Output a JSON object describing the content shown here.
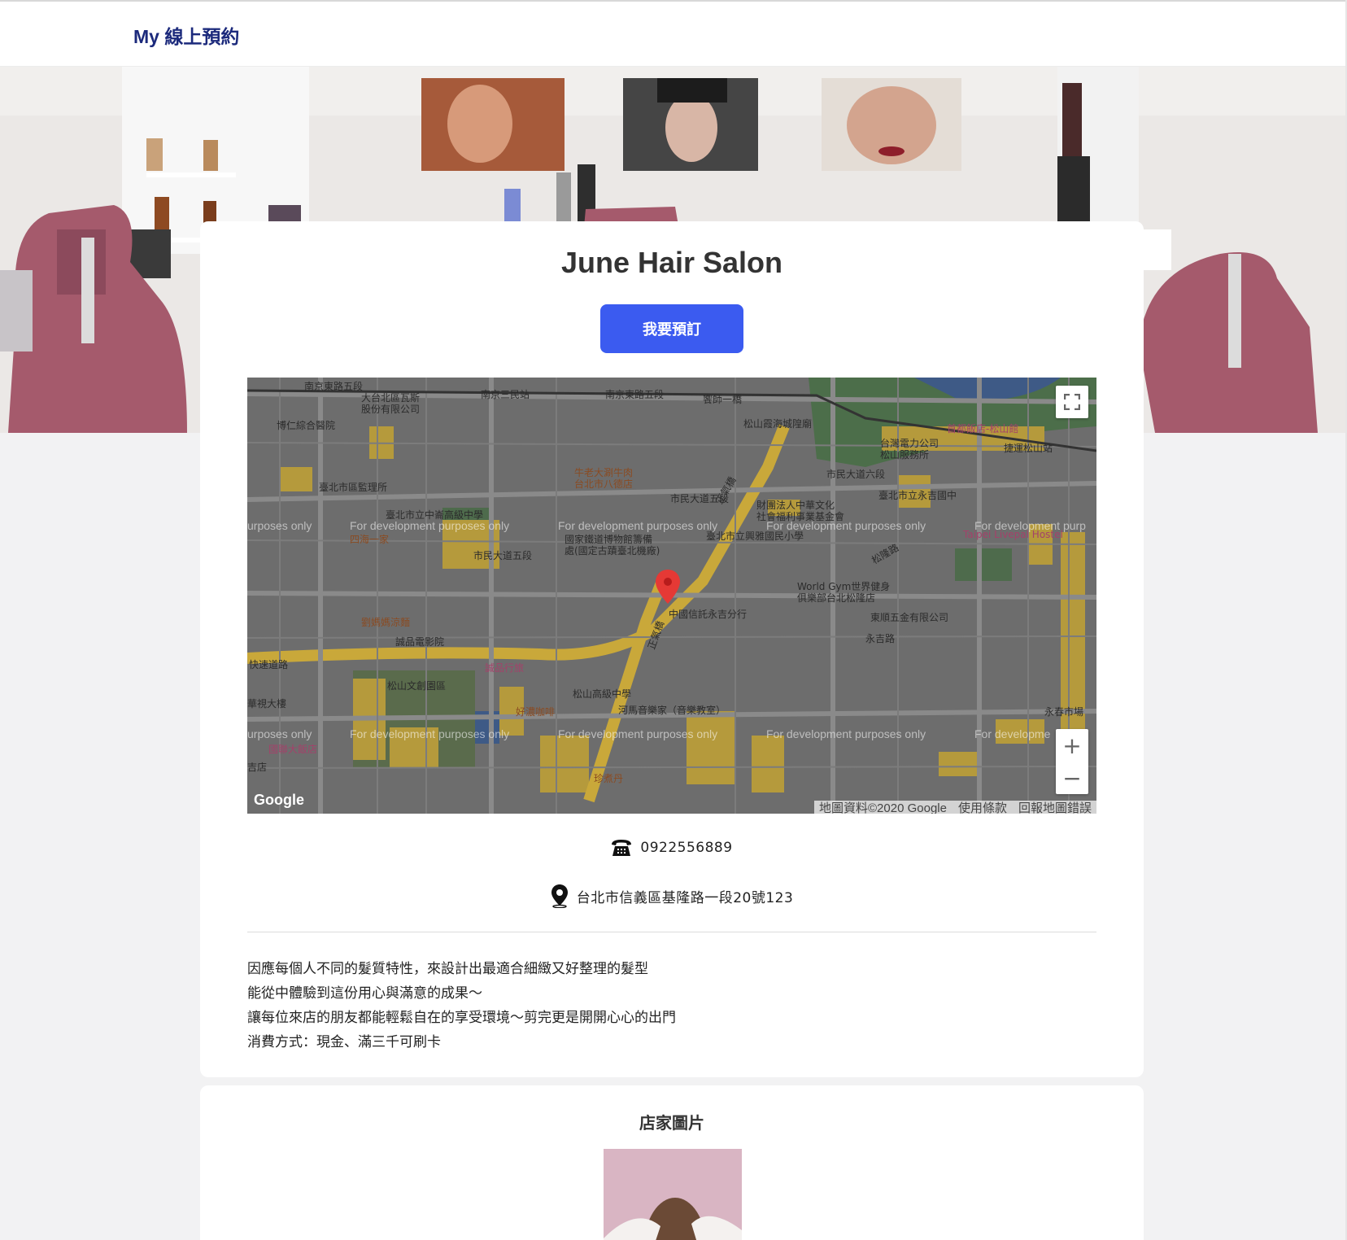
{
  "nav": {
    "brand": "My 線上預約"
  },
  "shop": {
    "name": "June Hair Salon",
    "book_label": "我要預訂",
    "phone": "0922556889",
    "address": "台北市信義區基隆路一段20號123",
    "description": [
      "因應每個人不同的髮質特性，來設計出最適合細緻又好整理的髮型",
      "能從中體驗到這份用心與滿意的成果～",
      "讓每位來店的朋友都能輕鬆自在的享受環境～剪完更是開開心心的出門",
      "消費方式：現金、滿三千可刷卡"
    ]
  },
  "map": {
    "dev_watermark": "For development purposes only",
    "dev_watermark_partial_left": "urposes only",
    "dev_watermark_partial_right_top": "For development purp",
    "dev_watermark_partial_right_bottom": "For developme",
    "google_logo": "Google",
    "footer": {
      "data": "地圖資料©2020 Google",
      "terms": "使用條款",
      "report": "回報地圖錯誤"
    },
    "zoom_in": "+",
    "zoom_out": "−",
    "labels": {
      "l1": "南京東路五段",
      "l2": "大台北區瓦斯\n股份有限公司",
      "l3": "南京三民站",
      "l4": "南京東路五段",
      "l5": "饗師一橋",
      "l6": "博仁綜合醫院",
      "l7": "松山霞海城隍廟",
      "l8": "首都飯店-松山館",
      "l9": "台灣電力公司\n松山服務所",
      "l10": "捷運松山站",
      "l11": "牛老大涮牛肉\n台北市八德店",
      "l12": "臺北市區監理所",
      "l13": "市民大道五段",
      "l14": "市民大道六段",
      "l15": "臺北市立中崙高級中學",
      "l16": "財團法人中華文化\n社會福利事業基金會",
      "l17": "臺北市立永吉國中",
      "l18": "四海一家",
      "l19": "國家鐵道博物館籌備\n處(國定古蹟臺北機廠)",
      "l20": "臺北市立興雅國民小學",
      "l21": "Taipei Livepal Hostel",
      "l22": "市民大道五段",
      "l23": "World Gym世界健身\n俱樂部台北松隆店",
      "l24": "劉媽媽涼麵",
      "l25": "中國信託永吉分行",
      "l26": "東順五金有限公司",
      "l27": "誠品電影院",
      "l28": "永吉路",
      "l29": "快速道路",
      "l30": "誠品行旅",
      "l31": "松山文創園區",
      "l32": "松山高級中學",
      "l33": "華視大樓",
      "l34": "好濃咖啡",
      "l35": "河馬音樂家（音樂教室）",
      "l36": "永春市場",
      "l37": "國聯大飯店",
      "l38": "珍煮丹",
      "l39": "正氣橋",
      "l40": "正氣橋",
      "l41": "松隆路",
      "l42": "吉店"
    }
  },
  "photos": {
    "title": "店家圖片"
  },
  "colors": {
    "brand_navy": "#1c2a7c",
    "primary_button": "#3b5bf0",
    "pin_red": "#e53935"
  },
  "icons": {
    "phone": "phone-icon",
    "location": "location-pin-icon",
    "fullscreen": "fullscreen-icon"
  }
}
